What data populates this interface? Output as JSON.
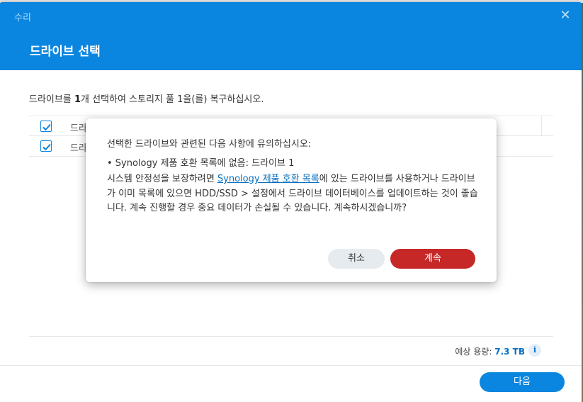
{
  "window": {
    "title": "수리",
    "close_icon": "close-icon"
  },
  "header": {
    "step_title": "드라이브 선택"
  },
  "main": {
    "instruction_pre": "드라이브를 ",
    "instruction_count": "1",
    "instruction_post": "개 선택하여 스토리지 풀 1을(를) 복구하십시오.",
    "table": {
      "header_label": "드라",
      "row_label": "드라"
    },
    "capacity_label": "예상 용량: ",
    "capacity_value": "7.3 TB",
    "info_icon": "i",
    "next_label": "다음"
  },
  "modal": {
    "intro": "선택한 드라이브와 관련된 다음 사항에 유의하십시오:",
    "bullet": "• Synology 제품 호환 목록에 없음: 드라이브 1",
    "body_pre": "시스템 안정성을 보장하려면 ",
    "body_link": "Synology 제품 호환 목록",
    "body_post": "에 있는 드라이브를 사용하거나 드라이브가 이미 목록에 있으면 HDD/SSD > 설정에서 드라이브 데이터베이스를 업데이트하는 것이 좋습니다. 계속 진행할 경우 중요 데이터가 손실될 수 있습니다. 계속하시겠습니까?",
    "cancel_label": "취소",
    "continue_label": "계속"
  },
  "colors": {
    "accent": "#0a86e0",
    "danger": "#c62828"
  }
}
